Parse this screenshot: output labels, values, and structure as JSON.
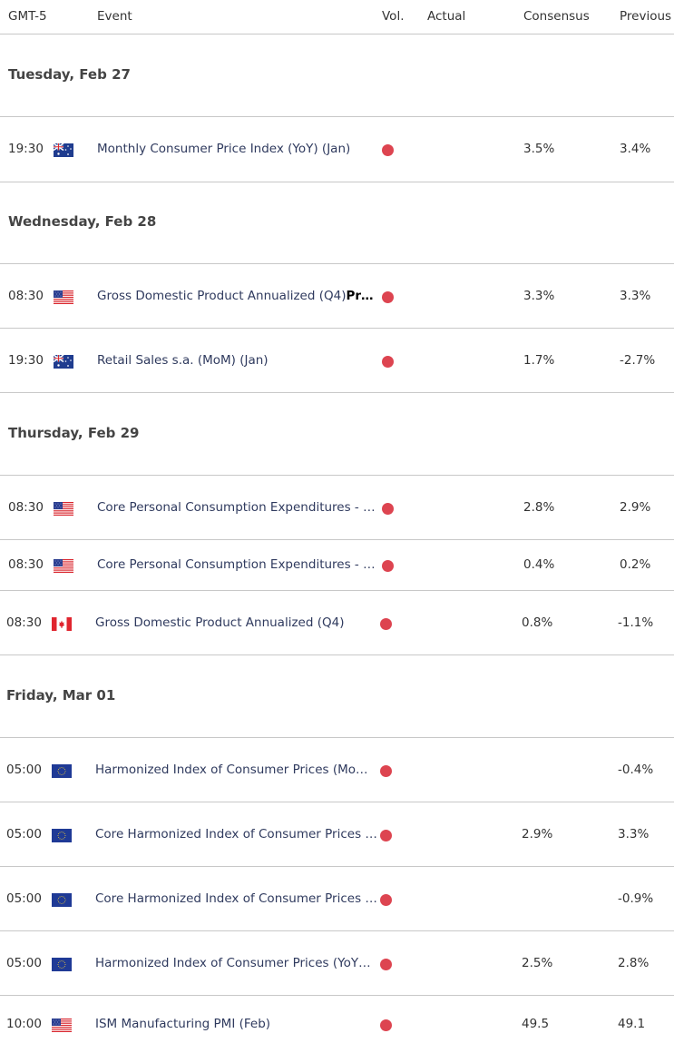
{
  "header": {
    "timezone": "GMT-5",
    "event": "Event",
    "vol": "Vol.",
    "actual": "Actual",
    "consensus": "Consensus",
    "previous": "Previous"
  },
  "colors": {
    "volatility_high": "#dd4450",
    "event_text": "#2f3a5e",
    "divider": "#c8c8c8"
  },
  "days": [
    {
      "label": "Tuesday, Feb 27",
      "events": [
        {
          "time": "19:30",
          "flag": "au-flag-icon",
          "event": "Monthly Consumer Price Index (YoY) (Jan)",
          "event_bold": "",
          "volatility": "high",
          "actual": "",
          "consensus": "3.5%",
          "previous": "3.4%"
        }
      ]
    },
    {
      "label": "Wednesday, Feb 28",
      "events": [
        {
          "time": "08:30",
          "flag": "us-flag-icon",
          "event": "Gross Domestic Product Annualized (Q4)",
          "event_bold": "Pr…",
          "volatility": "high",
          "actual": "",
          "consensus": "3.3%",
          "previous": "3.3%"
        },
        {
          "time": "19:30",
          "flag": "au-flag-icon",
          "event": "Retail Sales s.a. (MoM) (Jan)",
          "event_bold": "",
          "volatility": "high",
          "actual": "",
          "consensus": "1.7%",
          "previous": "-2.7%"
        }
      ]
    },
    {
      "label": "Thursday, Feb 29",
      "events": [
        {
          "time": "08:30",
          "flag": "us-flag-icon",
          "event": "Core Personal Consumption Expenditures - …",
          "event_bold": "",
          "volatility": "high",
          "actual": "",
          "consensus": "2.8%",
          "previous": "2.9%"
        },
        {
          "time": "08:30",
          "flag": "us-flag-icon",
          "event": "Core Personal Consumption Expenditures - …",
          "event_bold": "",
          "volatility": "high",
          "actual": "",
          "consensus": "0.4%",
          "previous": "0.2%"
        },
        {
          "time": "08:30",
          "flag": "ca-flag-icon",
          "event": "Gross Domestic Product Annualized (Q4)",
          "event_bold": "",
          "volatility": "high",
          "actual": "",
          "consensus": "0.8%",
          "previous": "-1.1%"
        }
      ]
    },
    {
      "label": "Friday, Mar 01",
      "events": [
        {
          "time": "05:00",
          "flag": "eu-flag-icon",
          "event": "Harmonized Index of Consumer Prices (Mo…",
          "event_bold": "",
          "volatility": "high",
          "actual": "",
          "consensus": "",
          "previous": "-0.4%"
        },
        {
          "time": "05:00",
          "flag": "eu-flag-icon",
          "event": "Core Harmonized Index of Consumer Prices …",
          "event_bold": "",
          "volatility": "high",
          "actual": "",
          "consensus": "2.9%",
          "previous": "3.3%"
        },
        {
          "time": "05:00",
          "flag": "eu-flag-icon",
          "event": "Core Harmonized Index of Consumer Prices …",
          "event_bold": "",
          "volatility": "high",
          "actual": "",
          "consensus": "",
          "previous": "-0.9%"
        },
        {
          "time": "05:00",
          "flag": "eu-flag-icon",
          "event": "Harmonized Index of Consumer Prices (YoY…",
          "event_bold": "",
          "volatility": "high",
          "actual": "",
          "consensus": "2.5%",
          "previous": "2.8%"
        },
        {
          "time": "10:00",
          "flag": "us-flag-icon",
          "event": "ISM Manufacturing PMI (Feb)",
          "event_bold": "",
          "volatility": "high",
          "actual": "",
          "consensus": "49.5",
          "previous": "49.1"
        }
      ]
    }
  ]
}
